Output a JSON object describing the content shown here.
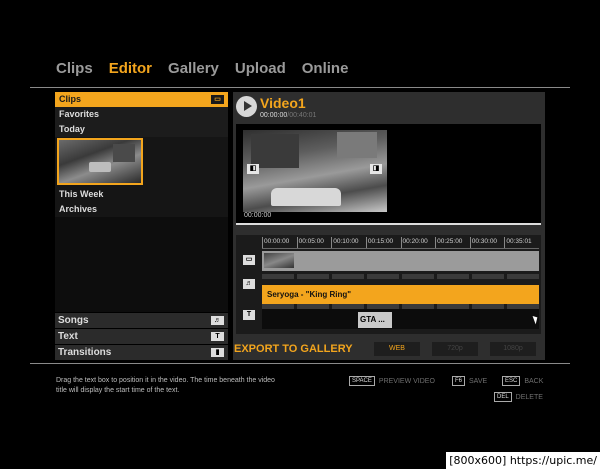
{
  "nav": {
    "tabs": [
      "Clips",
      "Editor",
      "Gallery",
      "Upload",
      "Online"
    ],
    "active": "Editor"
  },
  "library": {
    "header": "Clips",
    "items": [
      "Favorites",
      "Today",
      "This Week",
      "Archives"
    ],
    "bottom": [
      {
        "label": "Songs",
        "icon": "♬"
      },
      {
        "label": "Text",
        "icon": "T"
      },
      {
        "label": "Transitions",
        "icon": "▮"
      }
    ]
  },
  "video": {
    "title": "Video1",
    "position": "00:00:00",
    "duration": "/00:40:01",
    "player_time": "00:00:00"
  },
  "timeline": {
    "ticks": [
      "00:00:00",
      "00:05:00",
      "00:10:00",
      "00:15:00",
      "00:20:00",
      "00:25:00",
      "00:30:00",
      "00:35:01"
    ],
    "song_track": "Seryoga  - \"King Ring\"",
    "text_clip": "GTA ..."
  },
  "export": {
    "label": "EXPORT TO GALLERY",
    "options": [
      {
        "label": "WEB",
        "active": true
      },
      {
        "label": "720p",
        "active": false
      },
      {
        "label": "1080p",
        "active": false
      }
    ]
  },
  "help_text": "Drag the text box to position it in the video. The time beneath the video title will display the start time of the text.",
  "hints": {
    "preview": {
      "key": "SPACE",
      "label": "PREVIEW VIDEO"
    },
    "save": {
      "key": "F6",
      "label": "SAVE"
    },
    "back": {
      "key": "ESC",
      "label": "BACK"
    },
    "delete": {
      "key": "DEL",
      "label": "DELETE"
    }
  },
  "watermark": "[800x600] https://upic.me/",
  "colors": {
    "accent": "#f3a51d",
    "panel": "#2e2e2e"
  }
}
